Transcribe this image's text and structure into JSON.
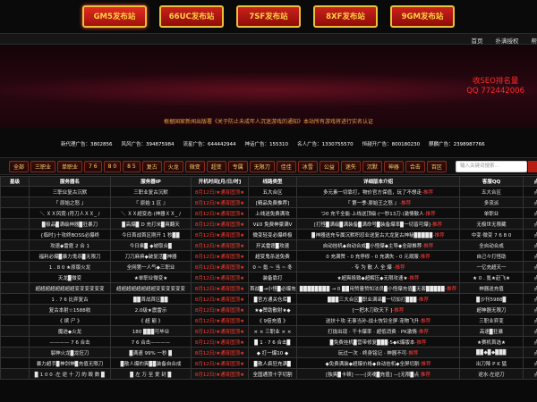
{
  "top_tabs": [
    "GM5发布站",
    "66UC发布站",
    "7SF发布站",
    "8XF发布站",
    "9GM发布站"
  ],
  "menu_links": [
    "首页",
    "扑满授权",
    "帮"
  ],
  "banner": {
    "seo_line1": "收SEO排名量",
    "seo_line2": "QQ 772442006",
    "notice": "根据国家新闻出版署《关于防止未成年人沉迷游戏的通知》本站所有游戏将进行实名认证"
  },
  "ads": [
    {
      "label": "新代理广告：",
      "num": "3802856"
    },
    {
      "label": "风风广告：",
      "num": "394875984"
    },
    {
      "label": "流星广告：",
      "num": "644442944"
    },
    {
      "label": "神话广告：",
      "num": "155310"
    },
    {
      "label": "名人广告：",
      "num": "1330755570"
    },
    {
      "label": "恒越开广告：",
      "num": "800180230"
    },
    {
      "label": "麒麟广告：",
      "num": "2398987766"
    }
  ],
  "categories": [
    "全部",
    "三职业",
    "单职业",
    "7 6",
    "8 0",
    "8 5",
    "复古",
    "火龙",
    "微变",
    "超变",
    "专属",
    "无限刀",
    "佳佳",
    "冰雪",
    "公益",
    "迷失",
    "沉默",
    "神器",
    "合击",
    "百区"
  ],
  "search_placeholder": "输入关键词搜索...",
  "table": {
    "headers": [
      "星级",
      "服务器名",
      "服务器IP",
      "开机时间[月/日/时]",
      "线路类型",
      "详细版本介绍",
      "客服QQ",
      "点"
    ],
    "rows": [
      [
        "",
        "三职业复古沉默",
        "三职业复古沉默",
        "8月12日/★通宵固顶★",
        "五大合区",
        "多元素一切靠打，物价官方保值，玩了不想走-推荐",
        "五大合区",
        "点"
      ],
      [
        "",
        "『 原始之怒 』",
        "『 原始 1 区 』",
        "8月12日/★通宵固顶★",
        "[精品免费推荐]",
        "『 第一季·原始王之怒 』-推荐",
        "多流派",
        "点"
      ],
      [
        "",
        "＼ ＸＸ风霓·(符刀人ＸＸ_ /",
        "＼ ＸＸ超变态·(神器ＸＸ_ /",
        "8月12日/★通宵固顶★",
        "上线送免费满攻",
        "つ0 充千全能·上线送顶级·(一秒13刀·)激情散人-推荐",
        "单职业",
        "点"
      ],
      [
        "",
        "▉极品▉满级神器▉狂暴刀",
        "▉高爆▉ D 充打米▉爽翻天",
        "8月12日/★通宵固顶★",
        "V£0 免费神豪满V",
        "[打怪▉满级▉满装备▉满命号▉装备爆率▉一切皆可爆]-推荐",
        "无极世无限藏",
        "点"
      ],
      [
        "",
        "{临时}十攻终BOSS必爆终",
        "今日首战首区刚开 1 秒▉▉",
        "8月12日/★通宵固顶★",
        "微变轻变必爆终极",
        "▉神器送充专属沉默积怼业送复古大龙复古神秘▉▉▉▉▉-推荐",
        "中变·微变 7 6 8 0",
        "点"
      ],
      [
        "",
        "攻速◆雷霆 2 合 1",
        "今日乘▉ ◆被取合▉",
        "8月12日/★通宵固顶★",
        "开关雷霆▉攻速",
        "自动挂机◆自动合成▉小怪爆◆主导◆全部推荐-推荐",
        "全自动合成",
        "点"
      ],
      [
        "",
        "福利必爆▉暴力鬼杀▉无限刀",
        "刀刀麻痹◆破复活▉神器",
        "8月12日/★通宵固顶★",
        "超变鬼杀送免费",
        "0 充满赞 - 0 充停修 - 0 充满失 - 0 元观服-推荐",
        "自己々打怪助",
        "点"
      ],
      [
        "",
        "1 . 8 0 ★原版火龙",
        "全网第一人气◆三职业",
        "8月12日/★通宵固顶★",
        "0 ~ 氪 ~ 当 ~ 冬",
        "· 专 为 散 人 全 爆 -推荐",
        "一亿充超天一",
        "点"
      ],
      [
        "",
        "天龙▉微变",
        "★单职业微变★",
        "8月12日/★通宵固顶★",
        "装备靠打",
        "★超爽极致◆超解压◆无限攻速★-推荐",
        "★ 0 . 氪★赶飞★",
        "点"
      ],
      [
        "",
        "超超超超超超超超变变变变变变",
        "超超超超超超超超变变变变变变",
        "8月12日/★通宵固顶★",
        "首战▉→小怪▉必爆充值",
        "▉▉▉▉▉▉▉▉ → 0 ▉▉用赞量赞知法员▉小怪爆充值▉无套▉▉▉▉▉-推荐",
        "神器送充值",
        "点"
      ],
      [
        "",
        "1 . 7 6 比弈复古",
        "▉▉首战首区▉▉",
        "8月12日/★通宵固顶★",
        "▉官方通关仓库▉",
        "▉▉▉三大合区▉职业满串▉一切加打▉▉▉-推荐",
        "▉沙刊5988▉",
        "点"
      ],
      [
        "",
        "复古本射☆1588收",
        "2.0级★震雷示",
        "8月12日/★通宵固顶★",
        "★◆赞助散射★◆",
        "[一把木刀砍天下 ]-推荐",
        "超神器无限刀",
        "点"
      ],
      [
        "",
        "《 缤 尸 》",
        "《 超 巅 》",
        "8月12日/★通宵固顶★",
        "《 9倍充值 》",
        "送扶十攻·无事当孙·战士快铃全屏·宠物飞升-推荐",
        "三职业弈变",
        "点"
      ],
      [
        "",
        "魔迹◆火龙",
        "180 ▉▉▉可毕业",
        "8月12日/★通宵固顶★",
        "× × 三职业 × ×",
        "打拢出现 · 干卡爆率 · 超低消费 · PK激情-推荐",
        "高速▉狂暴",
        "点"
      ],
      [
        "",
        "———— 7 6 合击",
        "7 6 合击————",
        "8月12日/★通宵固顶★",
        "▉ 1 · 7 6 合击▉",
        "▉免费挂机▉营带修复▉▉▉·5◆K爆版本-推荐",
        "★赛机首选★",
        "点"
      ],
      [
        "",
        "裂神火龙▉龙狂刀",
        "▉满速 99% 一秒 ▉",
        "8月12日/★通宵固顶★",
        "◆ 打一爆10 ◆",
        "玩过一次 · 终身铭记 · 神器不可-推荐",
        "▉▉◆▉◆▉▉▉",
        "点"
      ],
      [
        "",
        "暴力超手▉神剑神▉充值无限刀",
        "▉散人爆的爽▉▉装备自合成",
        "8月12日/★通宵固顶★",
        "▉散人疯狂充满▉",
        "◆免费满装◆超爆价格◆自动挂机◆全屏切割-推荐",
        "出刀降 P K 猛",
        "点"
      ],
      [
        "",
        "▉ 1 0 0 ·左 逆 十 刀 的 毁 数 ▉",
        "▉ 左 万 至 爱 封 ▉",
        "8月12日/★通宵固顶★",
        "全国通顶十字切割",
        "[独爽▉卡顿] ——[灵魂▉充值] —[无限▉点 推荐",
        "逆水·左逆刀",
        "点"
      ]
    ]
  },
  "colors": {
    "tab_gold": "#ffd23f",
    "tab_red": "#c9201a",
    "time_red": "#ff3b2f",
    "seo_red": "#ff2a2a",
    "notice_orange": "#f0a24a"
  }
}
